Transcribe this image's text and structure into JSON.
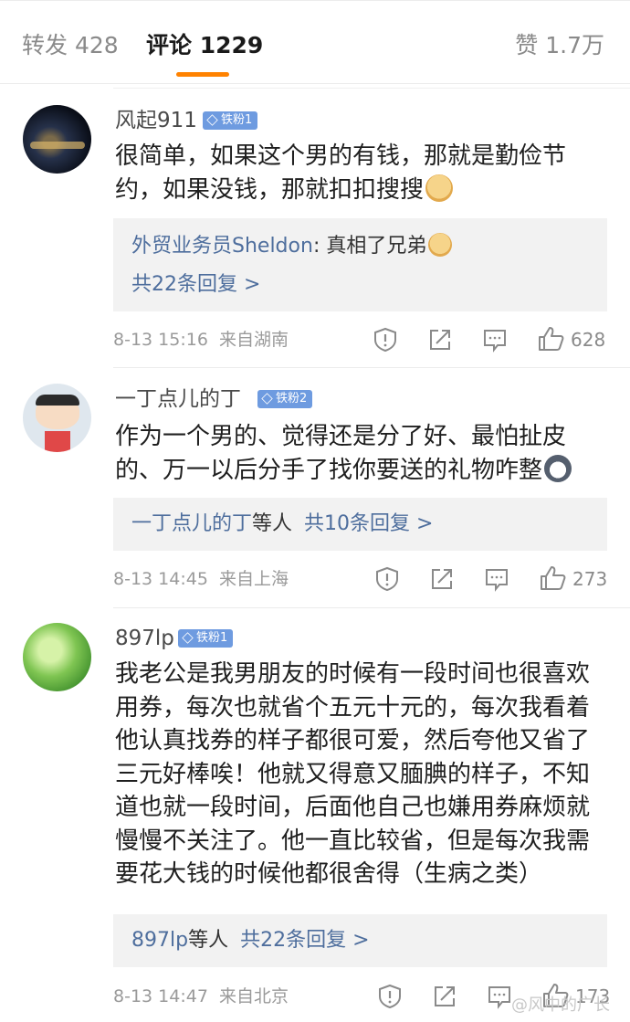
{
  "tabs": {
    "forward": "转发 428",
    "comments": "评论 1229",
    "likes": "赞 1.7万"
  },
  "comments": [
    {
      "username": "风起911",
      "badge": "铁粉1",
      "text": "很简单，如果这个男的有钱，那就是勤俭节约，如果没钱，那就扣扣搜搜",
      "emoji": "doge-emoji",
      "reply": {
        "author": "外贸业务员Sheldon",
        "text": ": 真相了兄弟",
        "emoji": "doge-emoji",
        "more": "共22条回复 >"
      },
      "time": "8-13 15:16",
      "location": "来自湖南",
      "likes": "628"
    },
    {
      "username": "一丁点儿的丁",
      "badge": "铁粉2",
      "text": "作为一个男的、觉得还是分了好、最怕扯皮的、万一以后分手了找你要送的礼物咋整",
      "emoji": "husky-emoji",
      "reply": {
        "author": "一丁点儿的丁",
        "suffix": "等人",
        "more": "共10条回复 >"
      },
      "time": "8-13 14:45",
      "location": "来自上海",
      "likes": "273"
    },
    {
      "username": "897lp",
      "badge": "铁粉1",
      "text": "我老公是我男朋友的时候有一段时间也很喜欢用券，每次也就省个五元十元的，每次我看着他认真找券的样子都很可爱，然后夸他又省了三元好棒唉！他就又得意又腼腆的样子，不知道也就一段时间，后面他自己也嫌用券麻烦就慢慢不关注了。他一直比较省，但是每次我需要花大钱的时候他都很舍得（生病之类）",
      "reply": {
        "author": "897lp",
        "suffix": "等人",
        "more": "共22条回复 >"
      },
      "time": "8-13 14:47",
      "location": "来自北京",
      "likes": "173"
    }
  ],
  "watermark": "@风中的广长",
  "colors": {
    "accent": "#ff8200",
    "link": "#4e6e9d",
    "badge": "#6e9be0",
    "reply_bg": "#f2f2f2"
  }
}
